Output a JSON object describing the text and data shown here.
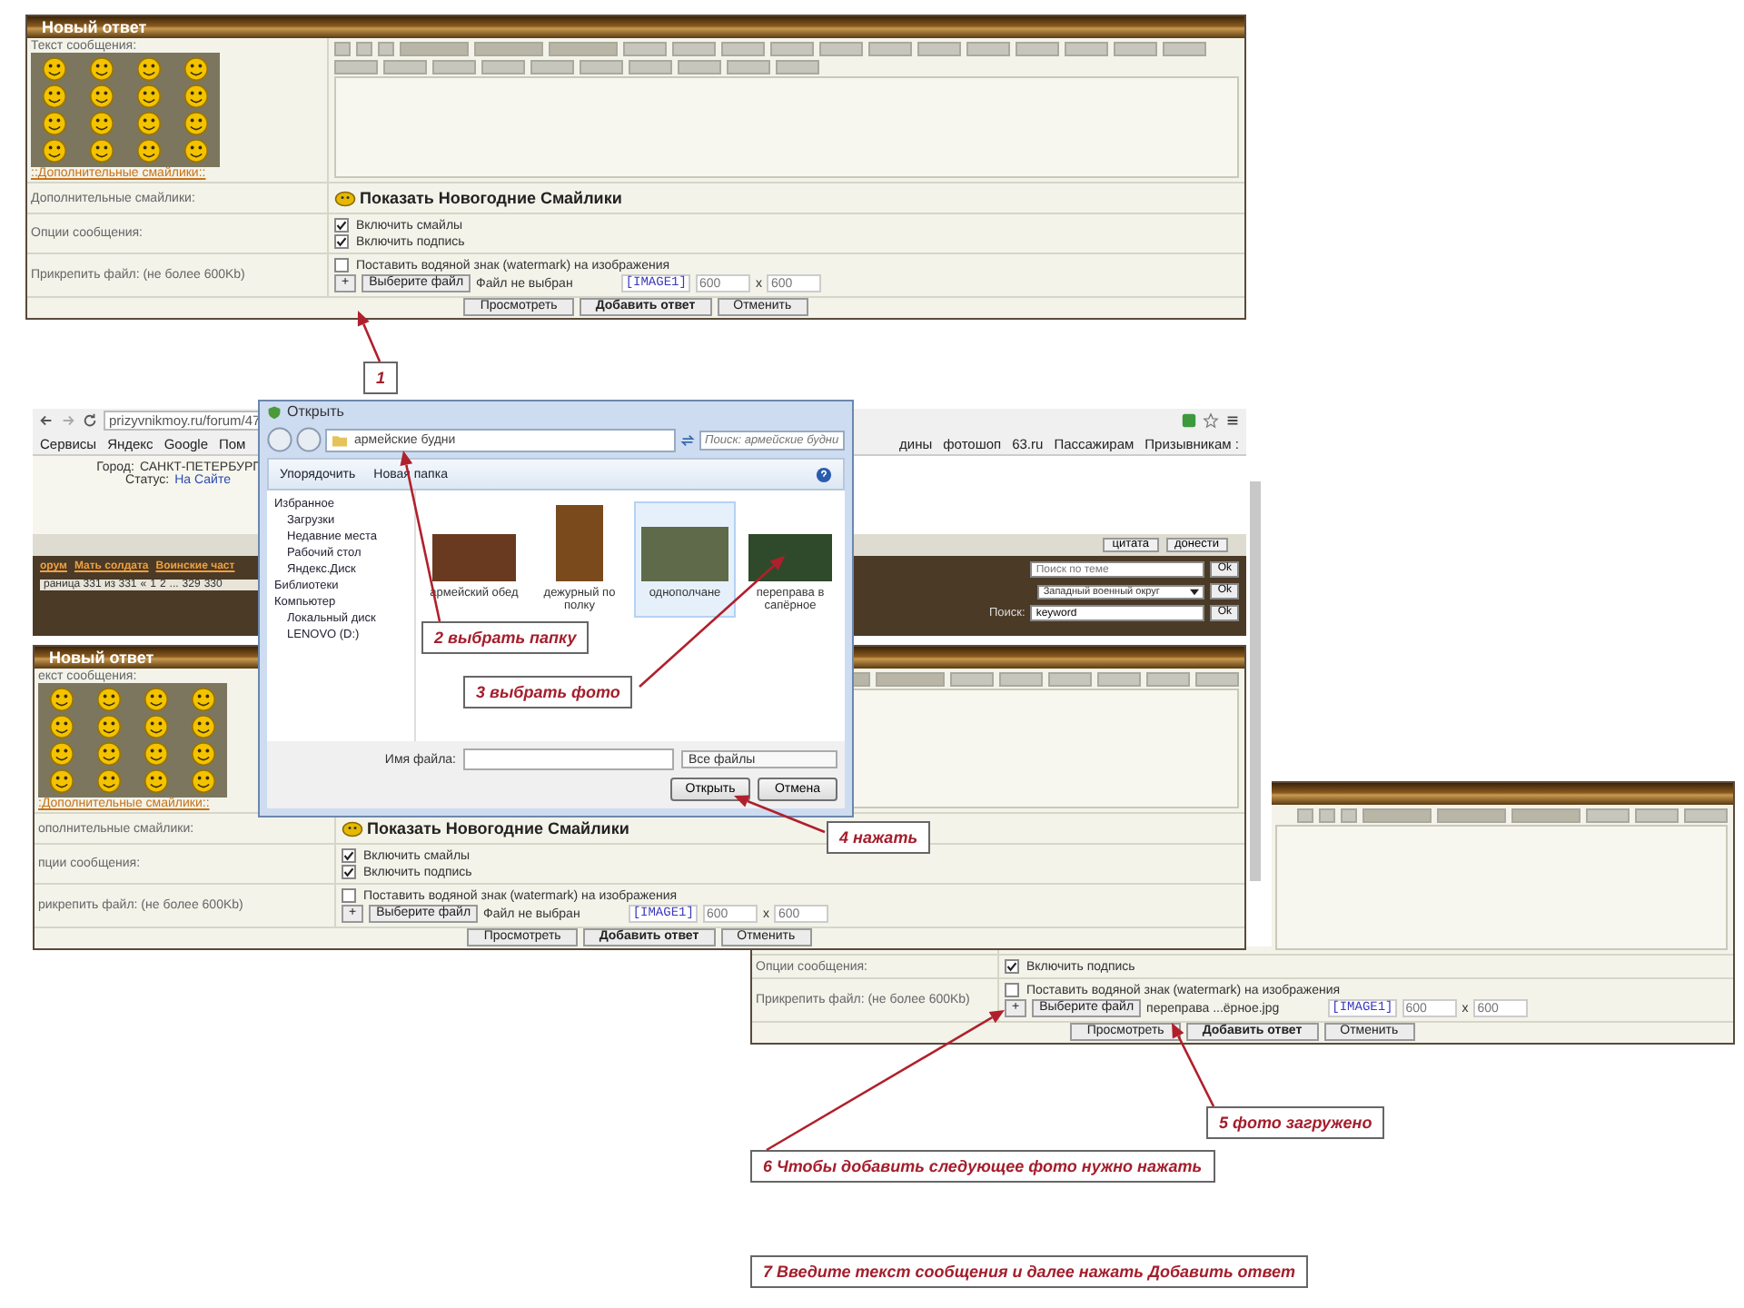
{
  "forms": [
    {
      "title": "Новый ответ",
      "rows": [
        {
          "kind": "message",
          "label": "Текст сообщения:",
          "smilies": true,
          "link": "::Дополнительные смайлики::"
        },
        {
          "kind": "extra",
          "label": "Дополнительные смайлики:",
          "text": "Показать Новогодние Смайлики"
        },
        {
          "kind": "options",
          "label": "Опции сообщения:",
          "options": [
            {
              "label": "Включить смайлы",
              "checked": true
            },
            {
              "label": "Включить подпись",
              "checked": true
            }
          ]
        },
        {
          "kind": "attach",
          "label": "Прикрепить файл: (не более 600Kb)",
          "watermark": {
            "label": "Поставить водяной знак (watermark) на изображения",
            "checked": false
          },
          "add": "+",
          "choose": "Выберите файл",
          "file": "Файл не выбран",
          "tag": "[IMAGE1]",
          "width_placeholder": "600",
          "separator": "x",
          "height_placeholder": "600"
        }
      ],
      "buttons": [
        {
          "label": "Просмотреть",
          "primary": false
        },
        {
          "label": "Добавить ответ",
          "primary": true
        },
        {
          "label": "Отменить",
          "primary": false
        }
      ]
    },
    {
      "title": "Новый ответ",
      "rows": [
        {
          "kind": "message",
          "label": "екст сообщения:",
          "smilies": true,
          "link": ":Дополнительные смайлики::"
        },
        {
          "kind": "extra",
          "label": "ополнительные смайлики:",
          "text": "Показать Новогодние Смайлики"
        },
        {
          "kind": "options",
          "label": "пции сообщения:",
          "options": [
            {
              "label": "Включить смайлы",
              "checked": true
            },
            {
              "label": "Включить подпись",
              "checked": true
            }
          ]
        },
        {
          "kind": "attach",
          "label": "рикрепить файл: (не более 600Kb)",
          "watermark": {
            "label": "Поставить водяной знак (watermark) на изображения",
            "checked": false
          },
          "add": "+",
          "choose": "Выберите файл",
          "file": "Файл не выбран",
          "tag": "[IMAGE1]",
          "width_placeholder": "600",
          "separator": "x",
          "height_placeholder": "600"
        }
      ],
      "buttons": [
        {
          "label": "Просмотреть",
          "primary": false
        },
        {
          "label": "Добавить ответ",
          "primary": true
        },
        {
          "label": "Отменить",
          "primary": false
        }
      ]
    },
    {
      "rows": [
        {
          "kind": "message"
        },
        {
          "kind": "options",
          "label": "Опции сообщения:",
          "options": [
            {
              "label": "Включить подпись",
              "checked": true
            }
          ]
        },
        {
          "kind": "attach",
          "label": "Прикрепить файл: (не более 600Kb)",
          "watermark": {
            "label": "Поставить водяной знак (watermark) на изображения",
            "checked": false
          },
          "add": "+",
          "choose": "Выберите файл",
          "file": "переправа ...ёрное.jpg",
          "tag": "[IMAGE1]",
          "width_placeholder": "600",
          "separator": "x",
          "height_placeholder": "600"
        }
      ],
      "buttons": [
        {
          "label": "Просмотреть",
          "primary": false
        },
        {
          "label": "Добавить ответ",
          "primary": true
        },
        {
          "label": "Отменить",
          "primary": false
        }
      ]
    }
  ],
  "browser": {
    "url": "prizyvnikmoy.ru/forum/47",
    "bookmarks_left": [
      "Сервисы",
      "Яндекс",
      "Google",
      "Пом"
    ],
    "bookmarks_right": [
      "дины",
      "фотошоп",
      "63.ru",
      "Пассажирам",
      "Призывникам :"
    ],
    "profile": [
      {
        "label": "Город:",
        "value": "САНКТ-ПЕТЕРБУРГ",
        "link": false
      },
      {
        "label": "Статус:",
        "value": "На Сайте",
        "link": true
      }
    ],
    "post_buttons": [
      "цитата",
      "донести"
    ],
    "breadcrumbs": [
      "орум",
      "Мать солдата",
      "Воинские част"
    ],
    "page_info": "раница 331 из 331",
    "pager": [
      "«",
      "1",
      "2",
      "...",
      "329",
      "330"
    ],
    "topic_search_placeholder": "Поиск по теме",
    "district": "Западный военный округ",
    "search_label": "Поиск:",
    "search_value": "keyword",
    "ok": [
      "Ok",
      "Ok",
      "Ok"
    ]
  },
  "dialog": {
    "title": "Открыть",
    "path": "армейские будни",
    "search_placeholder": "Поиск: армейские будни",
    "toolbar": [
      "Упорядочить",
      "Новая папка"
    ],
    "sidebar": [
      {
        "label": "Избранное",
        "children": [
          {
            "label": "Загрузки"
          },
          {
            "label": "Недавние места"
          },
          {
            "label": "Рабочий стол"
          },
          {
            "label": "Яндекс.Диск"
          }
        ]
      },
      {
        "label": "Библиотеки"
      },
      {
        "label": "Компьютер",
        "children": [
          {
            "label": "Локальный диск"
          },
          {
            "label": "LENOVO (D:)"
          }
        ]
      }
    ],
    "files": [
      {
        "name": "армейский обед",
        "selected": false
      },
      {
        "name": "дежурный по полку",
        "selected": false
      },
      {
        "name": "однополчане",
        "selected": true
      },
      {
        "name": "переправа в сапёрное",
        "selected": false
      }
    ],
    "file_name_label": "Имя файла:",
    "file_type": "Все файлы",
    "open": "Открыть",
    "cancel": "Отмена"
  },
  "annotations": [
    {
      "text": "1"
    },
    {
      "text": "2 выбрать папку"
    },
    {
      "text": "3 выбрать фото"
    },
    {
      "text": "4 нажать"
    },
    {
      "text": "5 фото загружено"
    },
    {
      "text": "6 Чтобы добавить следующее фото нужно нажать"
    },
    {
      "text": "7 Введите текст сообщения и далее нажать Добавить ответ"
    }
  ]
}
